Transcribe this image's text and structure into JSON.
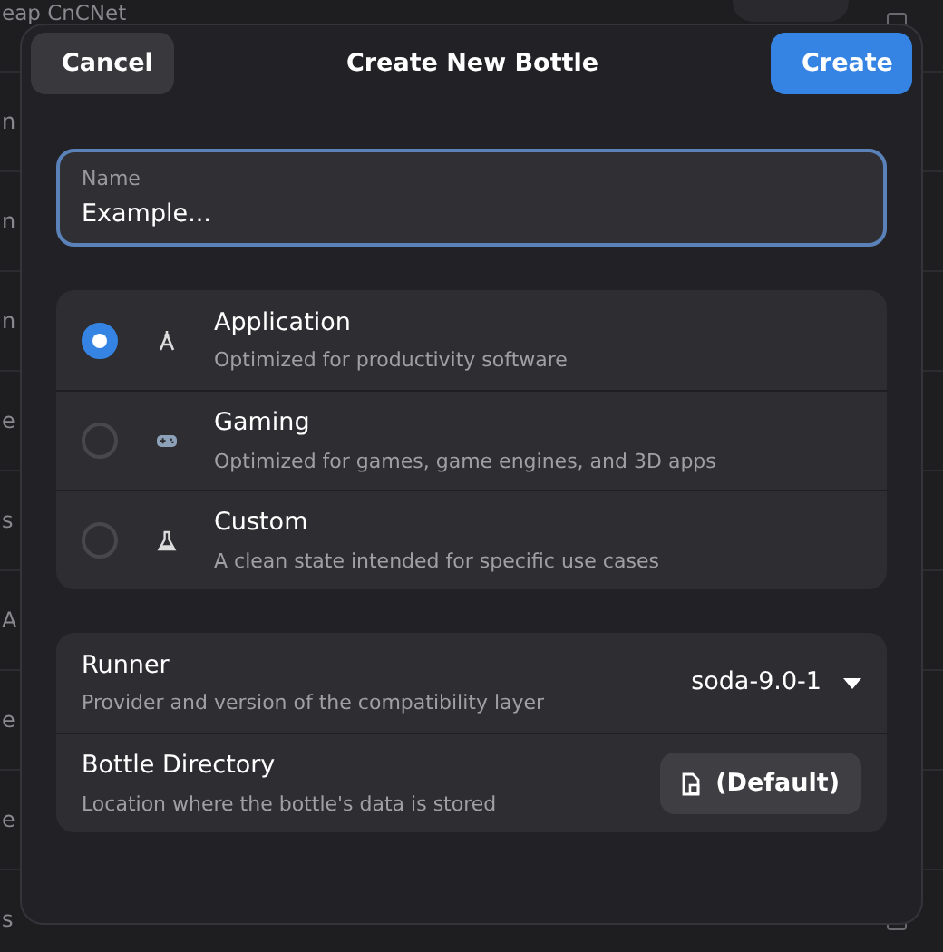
{
  "background_list": {
    "rows": [
      {
        "text": "eap CnCNet",
        "tag": true
      },
      {
        "text": "n"
      },
      {
        "text": "n"
      },
      {
        "text": "n"
      },
      {
        "text": "e"
      },
      {
        "text": "s"
      },
      {
        "text": "A"
      },
      {
        "text": "e"
      },
      {
        "text": "e"
      },
      {
        "text": "s"
      }
    ]
  },
  "dialog": {
    "title": "Create New Bottle",
    "cancel": "Cancel",
    "create": "Create",
    "name_field": {
      "label": "Name",
      "value": "Example..."
    },
    "environments": [
      {
        "kind": "compass",
        "title": "Application",
        "subtitle": "Optimized for productivity software",
        "selected": true
      },
      {
        "kind": "gamepad",
        "title": "Gaming",
        "subtitle": "Optimized for games, game engines, and 3D apps",
        "selected": false
      },
      {
        "kind": "flask",
        "title": "Custom",
        "subtitle": "A clean state intended for specific use cases",
        "selected": false
      }
    ],
    "settings": [
      {
        "kind": "dropdown",
        "title": "Runner",
        "subtitle": "Provider and version of the compatibility layer",
        "value": "soda-9.0-1"
      },
      {
        "kind": "button",
        "title": "Bottle Directory",
        "subtitle": "Location where the bottle's data is stored",
        "value": "(Default)"
      }
    ]
  }
}
